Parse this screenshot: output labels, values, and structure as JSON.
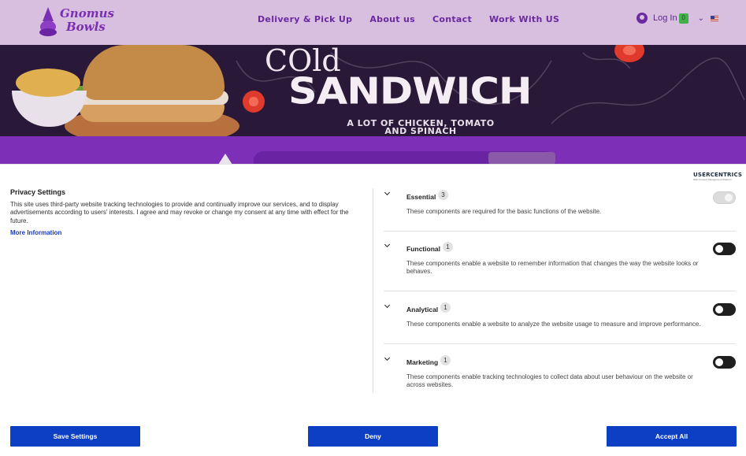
{
  "site": {
    "logo_line1": "Gnomus",
    "logo_line2": "Bowls",
    "nav": [
      "Delivery & Pick Up",
      "About us",
      "Contact",
      "Work With US"
    ],
    "login_label": "Log In",
    "cart_count": "0"
  },
  "hero": {
    "line1": "COld",
    "line2": "SANDWICH",
    "subtitle_line1": "A LOT OF CHICKEN, TOMATO",
    "subtitle_line2": "AND SPINACH"
  },
  "consent": {
    "brand_name": "USERCENTRICS",
    "brand_tagline": "Web Consent Management Platform",
    "title": "Privacy Settings",
    "description": "This site uses third-party website tracking technologies to provide and continually improve our services, and to display advertisements according to users' interests. I agree and may revoke or change my consent at any time with effect for the future.",
    "more_info": "More Information",
    "categories": [
      {
        "title": "Essential",
        "count": "3",
        "description": "These components are required for the basic functions of the website.",
        "enabled": true,
        "locked": true
      },
      {
        "title": "Functional",
        "count": "1",
        "description": "These components enable a website to remember information that changes the way the website looks or behaves.",
        "enabled": false,
        "locked": false
      },
      {
        "title": "Analytical",
        "count": "1",
        "description": "These components enable a website to analyze the website usage to measure and improve performance.",
        "enabled": false,
        "locked": false
      },
      {
        "title": "Marketing",
        "count": "1",
        "description": "These components enable tracking technologies to collect data about user behaviour on the website or across websites.",
        "enabled": false,
        "locked": false
      }
    ],
    "buttons": {
      "save": "Save Settings",
      "deny": "Deny",
      "accept": "Accept All"
    },
    "colors": {
      "button": "#0d3fc4",
      "link": "#1a3bbd"
    }
  }
}
